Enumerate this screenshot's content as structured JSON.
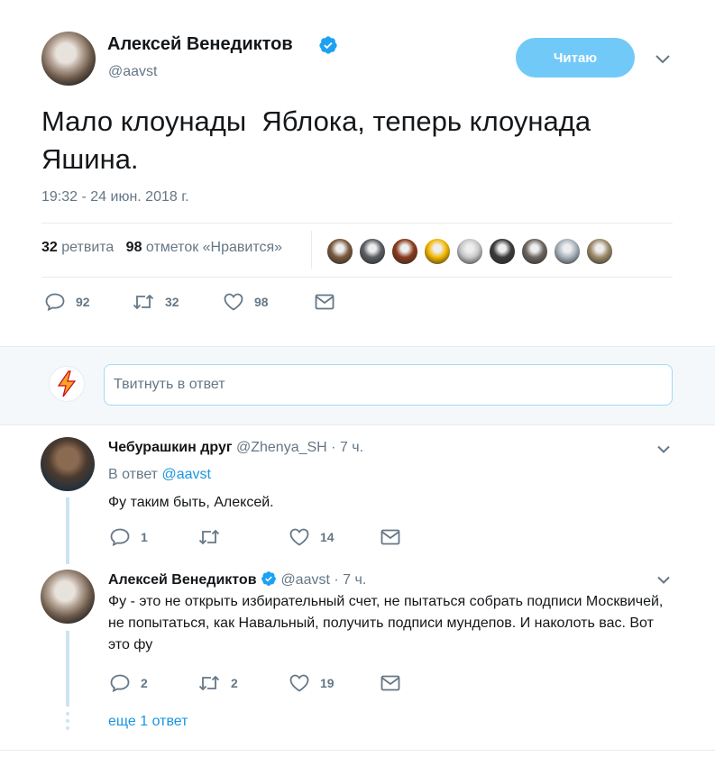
{
  "tweet": {
    "author_name": "Алексей Венедиктов",
    "handle": "@aavst",
    "follow_label": "Читаю",
    "text": "Мало клоунады  Яблока, теперь клоунада Яшина.",
    "timestamp": "19:32 - 24 июн. 2018 г.",
    "retweets_count": "32",
    "retweets_label": "ретвита",
    "likes_count": "98",
    "likes_label": "отметок «Нравится»",
    "actions": {
      "replies": "92",
      "retweets": "32",
      "likes": "98"
    },
    "liker_colors": [
      "#7a5a3f",
      "#5b5e63",
      "#8a3b1e",
      "#f5b800",
      "#c9c9c9",
      "#3b3b3b",
      "#6e6660",
      "#a9b3bd",
      "#9c8b6a"
    ]
  },
  "reply_box": {
    "placeholder": "Твитнуть в ответ"
  },
  "replies": [
    {
      "author_name": "Чебурашкин друг",
      "handle": "@Zhenya_SH",
      "time": "· 7 ч.",
      "reply_to_label": "В ответ",
      "reply_to_handle": "@aavst",
      "text": "Фу таким быть, Алексей.",
      "actions": {
        "replies": "1",
        "retweets": "",
        "likes": "14"
      }
    },
    {
      "author_name": "Алексей Венедиктов",
      "handle": "@aavst",
      "time": "· 7 ч.",
      "text": "Фу - это не открыть избирательный счет, не пытаться собрать подписи Москвичей, не попытаться, как Навальный, получить подписи мундепов. И наколоть вас. Вот это фу",
      "actions": {
        "replies": "2",
        "retweets": "2",
        "likes": "19"
      }
    }
  ],
  "show_more_label": "еще 1 ответ",
  "colors": {
    "accent": "#1b95e0",
    "follow_button": "#71c9f8",
    "secondary_text": "#657786",
    "divider": "#e6ecf0",
    "thread": "#cce4f2"
  }
}
